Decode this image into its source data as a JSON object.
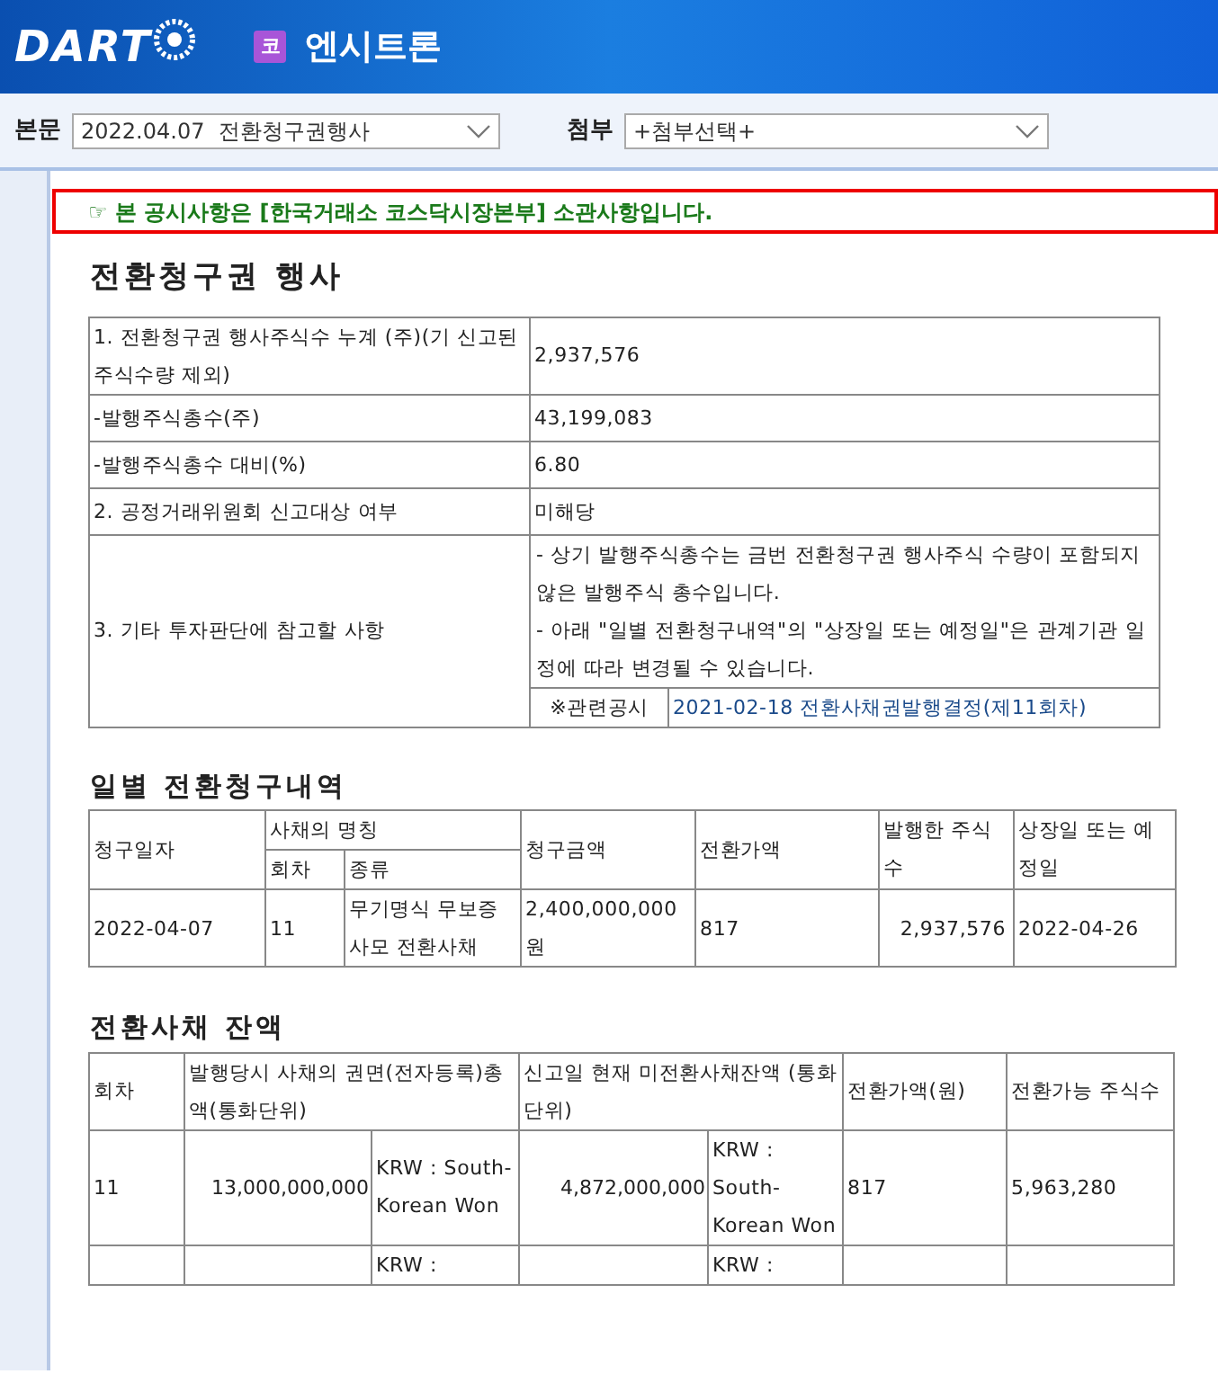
{
  "header": {
    "logo": "DART",
    "company_badge": "코",
    "company_name": "엔시트론"
  },
  "toolbar": {
    "main_doc": {
      "label": "본문",
      "value": "2022.04.07  전환청구권행사"
    },
    "attachment": {
      "label": "첨부",
      "value": "+첨부선택+"
    }
  },
  "notice": "☞ 본 공시사항은 [한국거래소 코스닥시장본부] 소관사항입니다.",
  "title": "전환청구권 행사",
  "summary_table": {
    "rows": [
      {
        "kind": "pair",
        "label": "1. 전환청구권 행사주식수 누계 (주)(기 신고된 주식수량 제외)",
        "value": "2,937,576"
      },
      {
        "kind": "pair",
        "label": "-발행주식총수(주)",
        "value": "43,199,083"
      },
      {
        "kind": "pair",
        "label": "-발행주식총수 대비(%)",
        "value": "6.80"
      },
      {
        "kind": "pair",
        "label": "2. 공정거래위원회 신고대상 여부",
        "value": "미해당"
      },
      {
        "kind": "notes",
        "label": "3. 기타 투자판단에 참고할 사항",
        "notes": [
          "- 상기 발행주식총수는 금번 전환청구권 행사주식 수량이 포함되지 않은 발행주식 총수입니다.",
          "- 아래 \"일별 전환청구내역\"의 \"상장일 또는 예정일\"은 관계기관 일정에 따라 변경될 수 있습니다."
        ],
        "related_label": "※관련공시",
        "related_link": "2021-02-18 전환사채권발행결정(제11회차)"
      }
    ]
  },
  "daily_title": "일별 전환청구내역",
  "daily_table": {
    "header": {
      "claim_date": "청구일자",
      "bond_name": "사채의 명칭",
      "round": "회차",
      "type": "종류",
      "amount": "청구금액",
      "price": "전환가액",
      "shares": "발행한 주식수",
      "listing": "상장일 또는 예정일"
    },
    "rows": [
      [
        "2022-04-07",
        "11",
        "무기명식 무보증 사모 전환사채",
        "2,400,000,000원",
        "817",
        "2,937,576",
        "2022-04-26"
      ]
    ]
  },
  "balance_title": "전환사채 잔액",
  "balance_table": {
    "header": {
      "round": "회차",
      "face": "발행당시 사채의 권면(전자등록)총액(통화단위)",
      "remaining": "신고일 현재 미전환사채잔액 (통화단위)",
      "price": "전환가액(원)",
      "shares": "전환가능 주식수"
    },
    "rows": [
      {
        "round": "11",
        "face": "13,000,000,000",
        "face_unit": "KRW : South-Korean Won",
        "remaining": "4,872,000,000",
        "remaining_unit": "KRW : South-Korean Won",
        "price": "817",
        "shares": "5,963,280"
      },
      {
        "face_unit": "KRW :",
        "remaining_unit": "KRW :"
      }
    ]
  }
}
